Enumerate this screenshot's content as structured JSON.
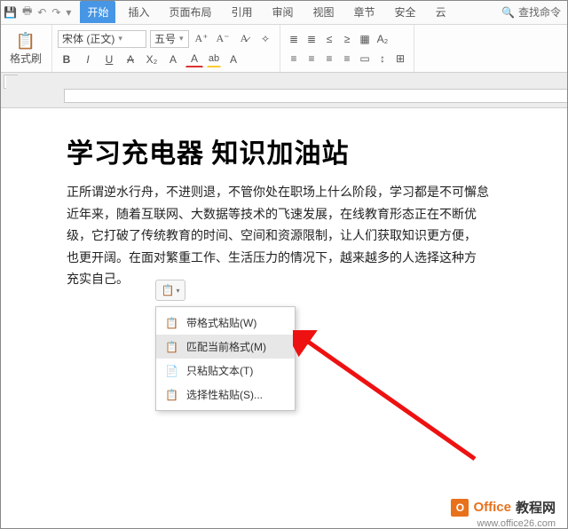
{
  "quickbar": {
    "save": "💾",
    "print": "🖶",
    "undo": "↶",
    "redo": "↷",
    "more": "▾"
  },
  "tabs": {
    "start": "开始",
    "insert": "插入",
    "layout": "页面布局",
    "reference": "引用",
    "review": "审阅",
    "view": "视图",
    "chapter": "章节",
    "safety": "安全",
    "yun": "云"
  },
  "search": {
    "icon": "🔍",
    "label": "查找命令"
  },
  "ribbon": {
    "paste_icon": "📋",
    "format_brush": "格式刷",
    "font_name": "宋体 (正文)",
    "font_size": "五号",
    "grow": "A⁺",
    "shrink": "A⁻",
    "clear": "A̷",
    "style": "✧",
    "bold": "B",
    "italic": "I",
    "underline": "U",
    "strike": "A",
    "sub": "X₂",
    "sup": "A",
    "fontcolor": "A",
    "highlight": "ab",
    "charbg": "A",
    "bullets": "≣",
    "numbers": "≣",
    "indent_dec": "≤",
    "indent_inc": "≥",
    "style2": "▦",
    "ab": "A₂",
    "align_l": "≡",
    "align_c": "≡",
    "align_r": "≡",
    "align_j": "≡",
    "shade": "▭",
    "linesp": "↕",
    "borders": "⊞"
  },
  "doc": {
    "title": "学习充电器 知识加油站",
    "p1": "正所谓逆水行舟，不进则退，不管你处在职场上什么阶段，学习都是不可懈怠",
    "p2": "近年来，随着互联网、大数据等技术的飞速发展，在线教育形态正在不断优",
    "p3": "级，它打破了传统教育的时间、空间和资源限制，让人们获取知识更方便，",
    "p4": "也更开阔。在面对繁重工作、生活压力的情况下，越来越多的人选择这种方",
    "p5": "充实自己。"
  },
  "pasteMenu": {
    "btn_icon": "📋",
    "i1_icon": "📋",
    "i1": "带格式粘贴(W)",
    "i2_icon": "📋",
    "i2": "匹配当前格式(M)",
    "i3_icon": "📄",
    "i3": "只粘贴文本(T)",
    "i4_icon": "📋",
    "i4": "选择性粘贴(S)..."
  },
  "watermark": {
    "logo": "O",
    "t1": "Office",
    "t2": "教程网",
    "url": "www.office26.com"
  }
}
